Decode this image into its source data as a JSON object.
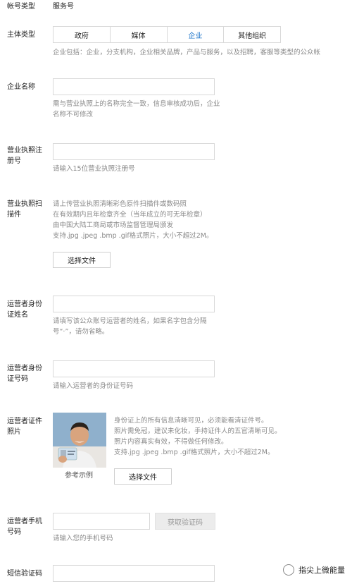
{
  "account_type": {
    "label": "帐号类型",
    "value": "服务号"
  },
  "entity_type": {
    "label": "主体类型",
    "tabs": [
      "政府",
      "媒体",
      "企业",
      "其他组织"
    ],
    "active_tab": "企业",
    "hint": "企业包括：企业，分支机构，企业相关品牌，产品与服务，以及招聘，客服等类型的公众帐"
  },
  "company_name": {
    "label": "企业名称",
    "hint": "需与营业执照上的名称完全一致，信息审核成功后，企业\n名称不可修改"
  },
  "license_no": {
    "label": "营业执照注\n册号",
    "hint": "请输入15位营业执照注册号"
  },
  "license_scan": {
    "label": "营业执照扫\n描件",
    "hint": "请上传营业执照清晰彩色原件扫描件或数码照\n在有效期内且年检章齐全（当年成立的可无年检章）\n由中国大陆工商局或市场监督管理局颁发\n支持.jpg .jpeg .bmp .gif格式照片，大小不超过2M。",
    "button": "选择文件"
  },
  "operator_name": {
    "label": "运营者身份\n证姓名",
    "hint": "请填写该公众账号运营者的姓名，如果名字包含分隔\n号“·”，请勿省略。"
  },
  "operator_id": {
    "label": "运营者身份\n证号码",
    "hint": "请输入运营者的身份证号码"
  },
  "operator_photo": {
    "label": "运营者证件\n照片",
    "hint": "身份证上的所有信息清晰可见，必须能看清证件号。\n照片需免冠，建议未化妆，手持证件人的五官清晰可见。\n照片内容真实有效，不得做任何修改。\n支持.jpg .jpeg .bmp .gif格式照片，大小不超过2M。",
    "example_caption": "参考示例",
    "button": "选择文件"
  },
  "operator_phone": {
    "label": "运营者手机\n号码",
    "button": "获取验证码",
    "hint": "请输入您的手机号码"
  },
  "sms_code": {
    "label": "短信验证码"
  },
  "watermark": {
    "text": "指尖上微能量"
  }
}
